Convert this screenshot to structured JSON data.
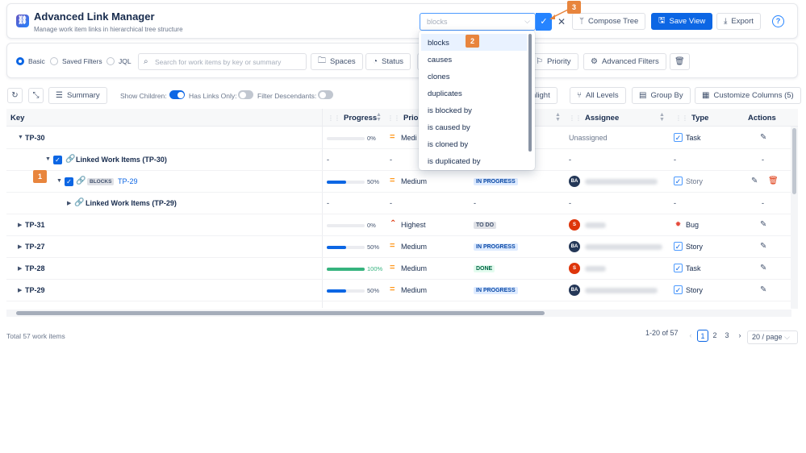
{
  "app": {
    "title": "Advanced Link Manager",
    "subtitle": "Manage work item links in hierarchical tree structure",
    "logo_icon": "link-manager-logo"
  },
  "header": {
    "link_type_select": {
      "value": "blocks",
      "placeholder": "blocks"
    },
    "compose_tree_label": "Compose Tree",
    "save_view_label": "Save View",
    "export_label": "Export",
    "help_label": "?"
  },
  "filters": {
    "modes": [
      "Basic",
      "Saved Filters",
      "JQL"
    ],
    "active_mode": "Basic",
    "search_placeholder": "Search for work items by key or summary",
    "buttons": [
      "Spaces",
      "Status",
      "Priority",
      "Advanced Filters"
    ]
  },
  "toolbar": {
    "summary_label": "Summary",
    "show_children_label": "Show Children:",
    "show_children": true,
    "has_links_only_label": "Has Links Only:",
    "has_links_only": false,
    "filter_descendants_label": "Filter Descendants:",
    "filter_descendants": false,
    "highlight_label": "hlight",
    "all_levels_label": "All Levels",
    "group_by_label": "Group By",
    "customize_columns_label": "Customize Columns (5)"
  },
  "columns": {
    "key": "Key",
    "progress": "Progress",
    "priority": "Priori",
    "assignee": "Assignee",
    "type": "Type",
    "actions": "Actions"
  },
  "rows": [
    {
      "key": "TP-30",
      "progress_label": "0%",
      "progress": 0,
      "priority": "Medi",
      "assignee": "Unassigned",
      "type": "Task"
    },
    {
      "label": "Linked Work Items (TP-30)",
      "progress": "-",
      "priority": "-",
      "assignee": "-",
      "type": "-",
      "action": "-"
    },
    {
      "relation": "BLOCKS",
      "key": "TP-29",
      "progress_label": "50%",
      "progress": 50,
      "priority": "Medium",
      "status": "IN PROGRESS",
      "avatar": "BA",
      "type": "Story"
    },
    {
      "label": "Linked Work Items (TP-29)",
      "progress": "-",
      "priority": "-",
      "status": "-",
      "assignee": "-",
      "type": "-",
      "action": "-"
    },
    {
      "key": "TP-31",
      "progress_label": "0%",
      "progress": 0,
      "priority": "Highest",
      "status": "TO DO",
      "avatar": "S",
      "type": "Bug"
    },
    {
      "key": "TP-27",
      "progress_label": "50%",
      "progress": 50,
      "priority": "Medium",
      "status": "IN PROGRESS",
      "avatar": "BA",
      "type": "Story"
    },
    {
      "key": "TP-28",
      "progress_label": "100%",
      "progress": 100,
      "priority": "Medium",
      "status": "DONE",
      "avatar": "S",
      "type": "Task"
    },
    {
      "key": "TP-29",
      "progress_label": "50%",
      "progress": 50,
      "priority": "Medium",
      "status": "IN PROGRESS",
      "avatar": "BA",
      "type": "Story"
    }
  ],
  "dropdown": {
    "options": [
      "blocks",
      "causes",
      "clones",
      "duplicates",
      "is blocked by",
      "is caused by",
      "is cloned by",
      "is duplicated by"
    ],
    "selected": "blocks"
  },
  "pagination": {
    "total": "Total 57 work items",
    "range": "1-20 of 57",
    "pages": [
      "1",
      "2",
      "3"
    ],
    "current": "1",
    "page_size": "20 / page"
  },
  "markers": [
    "1",
    "2",
    "3"
  ],
  "colors": {
    "primary": "#0c66e4",
    "marker": "#e8853d",
    "done": "#36b37e",
    "highest": "#de350b",
    "medium": "#ff991f",
    "bug": "#e5493a"
  }
}
